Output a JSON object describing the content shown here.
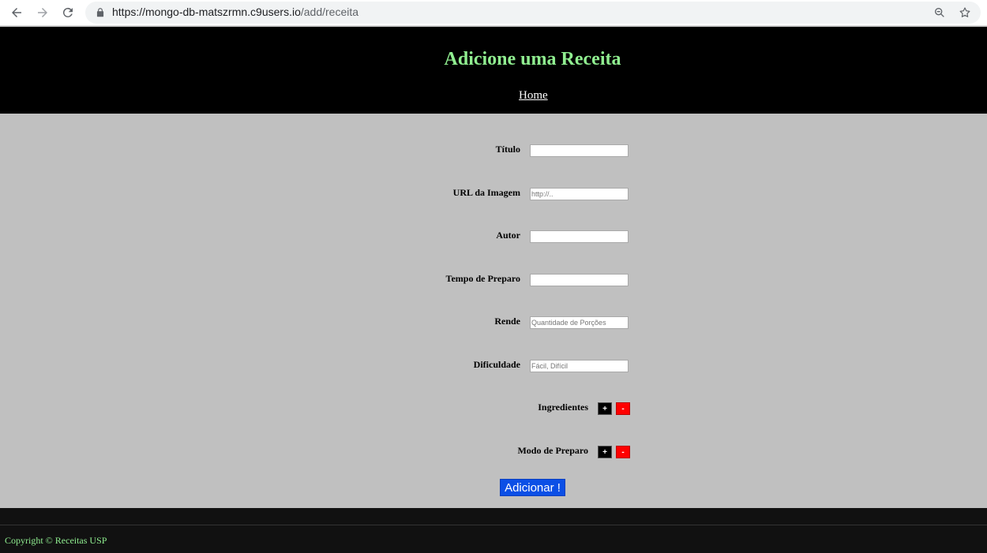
{
  "browser": {
    "url_host": "https://mongo-db-matszrmn.c9users.io",
    "url_path": "/add/receita",
    "icons": [
      "back-icon",
      "forward-icon",
      "reload-icon",
      "lock-icon",
      "zoom-icon",
      "star-icon"
    ]
  },
  "header": {
    "title": "Adicione uma Receita",
    "nav_home": "Home"
  },
  "form": {
    "titulo_label": "Título",
    "url_imagem_label": "URL da Imagem",
    "url_imagem_placeholder": "http://..",
    "autor_label": "Autor",
    "tempo_label": "Tempo de Preparo",
    "rende_label": "Rende",
    "rende_placeholder": "Quantidade de Porções",
    "dificuldade_label": "Dificuldade",
    "dificuldade_placeholder": "Fácil, Difícil",
    "ingredientes_label": "Ingredientes",
    "modo_label": "Modo de Preparo",
    "add_symbol": "+",
    "remove_symbol": "-",
    "submit_label": "Adicionar !"
  },
  "footer": {
    "copyright": "Copyright © Receitas USP"
  },
  "colors": {
    "header_bg": "#000000",
    "title_color": "#90ee90",
    "page_bg": "#c0c0c0",
    "submit_bg": "#0b4fe6",
    "remove_btn": "#ff0000",
    "footer_bg": "#111111"
  }
}
